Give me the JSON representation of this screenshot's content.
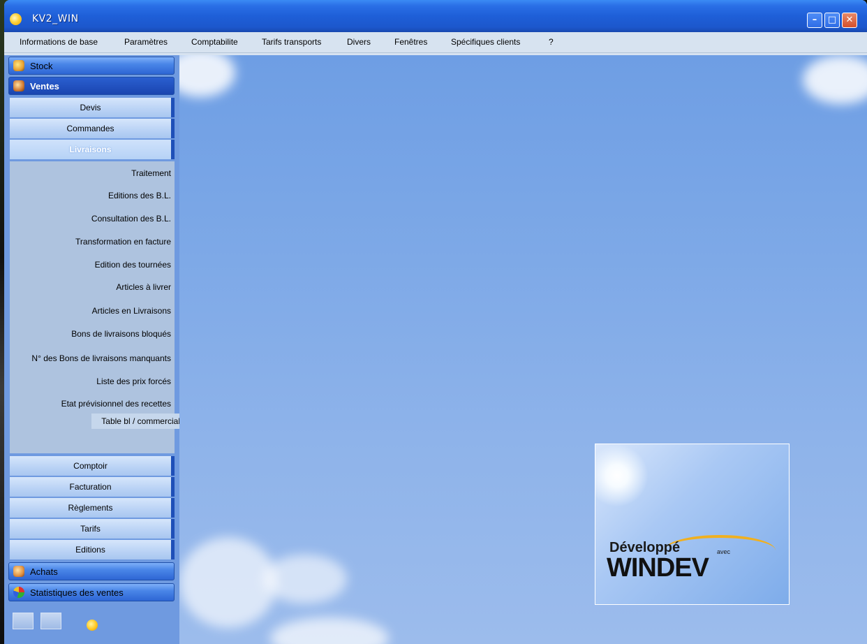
{
  "window": {
    "title": "KV2_WIN"
  },
  "menu": [
    "Informations de base",
    "Paramètres",
    "Comptabilite",
    "Tarifs transports",
    "Divers",
    "Fenêtres",
    "Spécifiques clients",
    "?"
  ],
  "sidebar": {
    "stock": "Stock",
    "ventes": "Ventes",
    "ventes_items": {
      "devis": "Devis",
      "commandes": "Commandes",
      "livraisons": "Livraisons",
      "comptoir": "Comptoir",
      "facturation": "Facturation",
      "reglements": "Règlements",
      "tarifs": "Tarifs",
      "editions": "Editions"
    },
    "livraisons_options": [
      "Traitement",
      "Editions des B.L.",
      "Consultation des B.L.",
      "Transformation en facture",
      "Edition des tournées",
      "Articles à livrer",
      "Articles en Livraisons",
      "Bons de livraisons bloqués",
      "N° des Bons de livraisons manquants",
      "Liste des prix forcés",
      "Etat prévisionnel des recettes",
      "Table bl / commercial"
    ],
    "achats": "Achats",
    "statistiques": "Statistiques des ventes"
  },
  "logo": {
    "line1": "Développé",
    "avec": "avec",
    "line2": "WINDEV"
  }
}
